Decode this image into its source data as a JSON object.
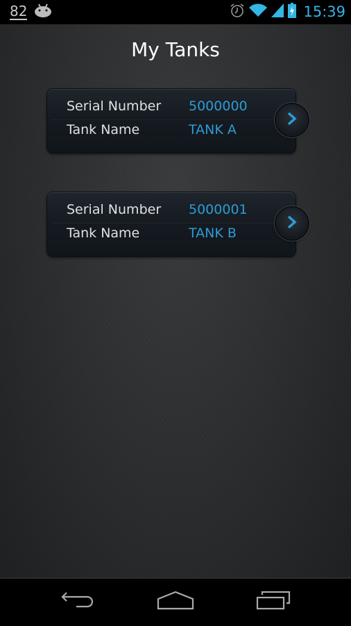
{
  "status_bar": {
    "notification_count": "82",
    "notification_icon": "android-icon",
    "icons": [
      "alarm-icon",
      "wifi-icon",
      "signal-icon",
      "battery-charging-icon"
    ],
    "time": "15:39",
    "accent_color": "#33b5e5"
  },
  "header": {
    "title": "My Tanks"
  },
  "tanks": [
    {
      "serial_label": "Serial Number",
      "serial_value": "5000000",
      "name_label": "Tank Name",
      "name_value": "TANK A"
    },
    {
      "serial_label": "Serial Number",
      "serial_value": "5000001",
      "name_label": "Tank Name",
      "name_value": "TANK B"
    }
  ],
  "colors": {
    "value_text": "#2e9bd6",
    "chevron": "#2e9bd6"
  },
  "nav_bar": {
    "buttons": [
      "back",
      "home",
      "recent-apps"
    ]
  }
}
